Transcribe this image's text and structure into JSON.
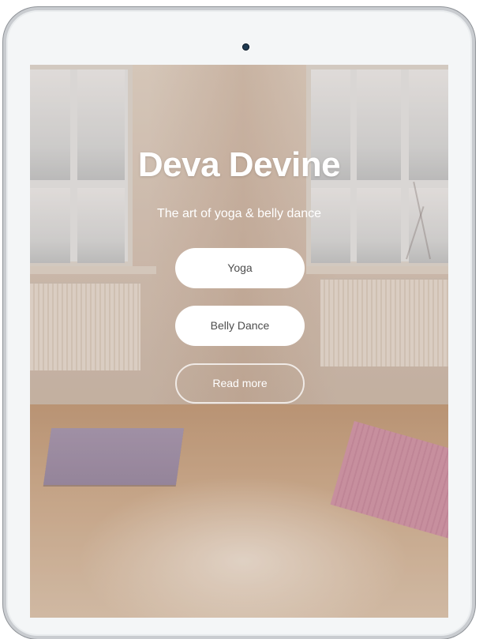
{
  "hero": {
    "title": "Deva Devine",
    "subtitle": "The art of yoga & belly dance"
  },
  "buttons": {
    "yoga": "Yoga",
    "belly_dance": "Belly Dance",
    "read_more": "Read more"
  },
  "colors": {
    "title_text": "#ffffff",
    "button_bg": "#ffffff",
    "button_text": "#4d4d4d",
    "device_frame": "#f4f6f7",
    "camera": "#1f3a52"
  }
}
